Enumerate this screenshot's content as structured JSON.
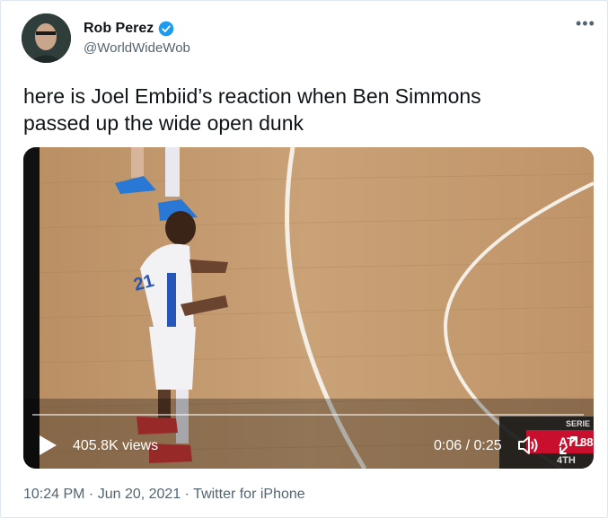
{
  "author": {
    "name": "Rob Perez",
    "handle": "@WorldWideWob",
    "verified": true
  },
  "tweet": {
    "text_line1": "here is Joel Embiid’s reaction when Ben Simmons",
    "text_line2": "passed up the wide open dunk"
  },
  "video": {
    "views": "405.8K views",
    "time": "0:06 / 0:25",
    "progress_fraction": 0.0,
    "scorebug": {
      "series": "SERIE",
      "team": "ATL",
      "score": "88",
      "quarter": "4TH"
    },
    "jersey_number": "21"
  },
  "footer": {
    "time": "10:24 PM",
    "date": "Jun 20, 2021",
    "source": "Twitter for iPhone",
    "separator": " · "
  },
  "colors": {
    "accent": "#1d9bf0",
    "muted": "#536471",
    "court": "#c69a6b"
  }
}
